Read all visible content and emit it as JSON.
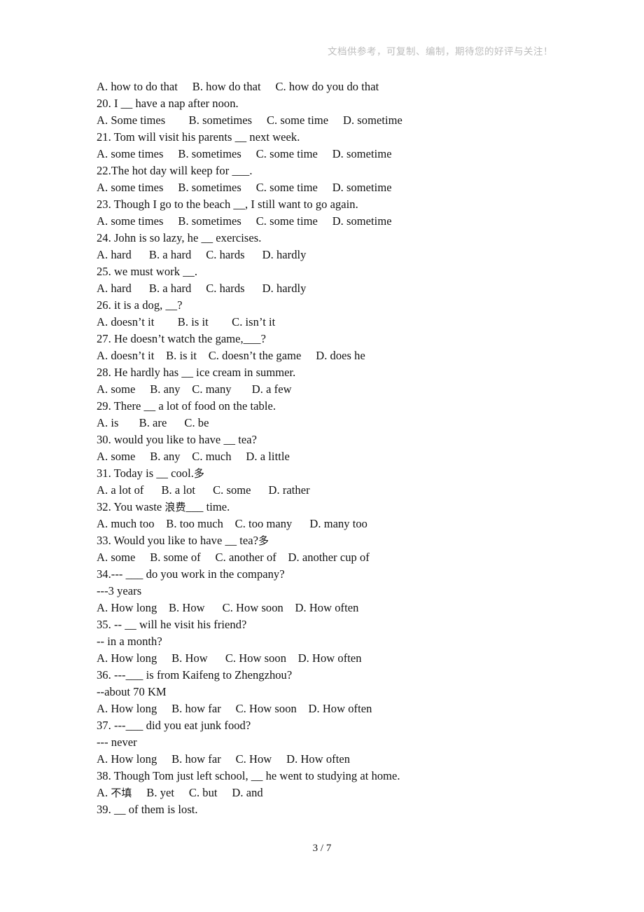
{
  "header": {
    "note": "文档供参考，可复制、编制，期待您的好评与关注！"
  },
  "footer": {
    "page_label": "3 / 7",
    "current_page": 3,
    "total_pages": 7
  },
  "document": {
    "lines": [
      "A. how to do that     B. how do that     C. how do you do that",
      "20. I __ have a nap after noon.",
      "A. Some times        B. sometimes     C. some time     D. sometime",
      "21. Tom will visit his parents __ next week.",
      "A. some times     B. sometimes     C. some time     D. sometime",
      "22.The hot day will keep for ___.",
      "A. some times     B. sometimes     C. some time     D. sometime",
      "23. Though I go to the beach __, I still want to go again.",
      "A. some times     B. sometimes     C. some time     D. sometime",
      "24. John is so lazy, he __ exercises.",
      "A. hard      B. a hard     C. hards      D. hardly",
      "25. we must work __.",
      "A. hard      B. a hard     C. hards      D. hardly",
      "26. it is a dog, __?",
      "A. doesn’t it        B. is it        C. isn’t it",
      "27. He doesn’t watch the game,___?",
      "A. doesn’t it    B. is it    C. doesn’t the game     D. does he",
      "28. He hardly has __ ice cream in summer.",
      "A. some     B. any    C. many       D. a few",
      "29. There __ a lot of food on the table.",
      "A. is       B. are      C. be",
      "30. would you like to have __ tea?",
      "A. some     B. any    C. much     D. a little",
      "31. Today is __ cool.多",
      "A. a lot of      B. a lot      C. some      D. rather",
      "32. You waste 浪费___ time.",
      "A. much too    B. too much    C. too many      D. many too",
      "33. Would you like to have __ tea?多",
      "A. some     B. some of     C. another of    D. another cup of",
      "34.--- ___ do you work in the company?",
      "---3 years",
      "A. How long    B. How      C. How soon    D. How often",
      "35. -- __ will he visit his friend?",
      "-- in a month?",
      "A. How long     B. How      C. How soon    D. How often",
      "36. ---___ is from Kaifeng to Zhengzhou?",
      "--about 70 KM",
      "A. How long     B. how far     C. How soon    D. How often",
      "37. ---___ did you eat junk food?",
      "--- never",
      "A. How long     B. how far     C. How     D. How often",
      "38. Though Tom just left school, __ he went to studying at home.",
      "A. 不填     B. yet     C. but     D. and",
      "39. __ of them is lost."
    ]
  }
}
